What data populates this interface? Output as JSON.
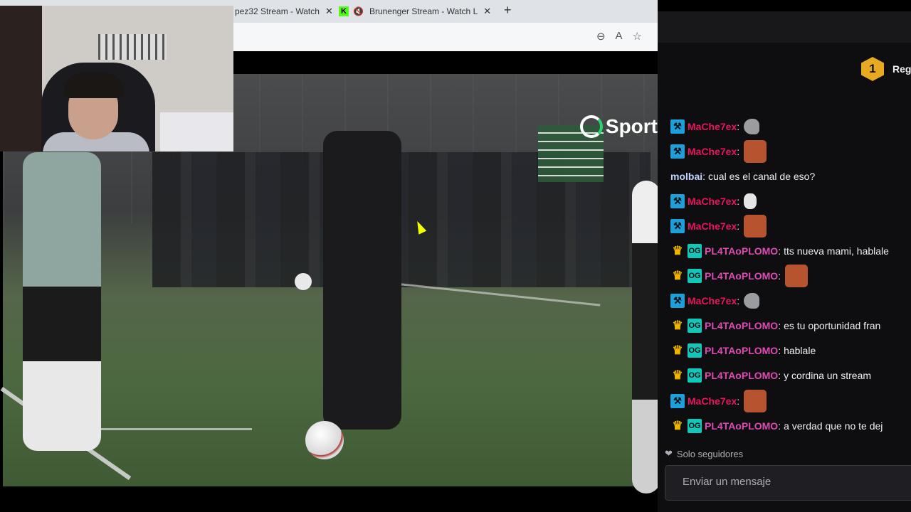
{
  "browser": {
    "tabs": [
      {
        "title": "pez32 Stream - Watch",
        "active": false
      },
      {
        "title": "Brunenger Stream - Watch L",
        "active": true,
        "favicon": "kick-icon",
        "muted": true
      }
    ],
    "new_tab_label": "+"
  },
  "video": {
    "brand_logo_text": "Sport"
  },
  "chat": {
    "rank": {
      "badge": "1",
      "label": "Reg"
    },
    "messages": [
      {
        "badges": [
          "mod"
        ],
        "user": "MaChe7ex",
        "user_color": "#e8155d",
        "text": "",
        "emote": "pigeon"
      },
      {
        "badges": [
          "mod"
        ],
        "user": "MaChe7ex",
        "user_color": "#e8155d",
        "text": "",
        "emote": "face"
      },
      {
        "badges": [],
        "user": "molbai",
        "user_color": "#c3d4ff",
        "text": "cual es el canal de eso?",
        "emote": ""
      },
      {
        "badges": [
          "mod"
        ],
        "user": "MaChe7ex",
        "user_color": "#e8155d",
        "text": "",
        "emote": "hand"
      },
      {
        "badges": [
          "mod"
        ],
        "user": "MaChe7ex",
        "user_color": "#e8155d",
        "text": "",
        "emote": "face"
      },
      {
        "badges": [
          "crown",
          "og"
        ],
        "user": "PL4TAoPLOMO",
        "user_color": "#e04ab4",
        "text": "tts nueva mami, hablale",
        "emote": ""
      },
      {
        "badges": [
          "crown",
          "og"
        ],
        "user": "PL4TAoPLOMO",
        "user_color": "#e04ab4",
        "text": "",
        "emote": "face"
      },
      {
        "badges": [
          "mod"
        ],
        "user": "MaChe7ex",
        "user_color": "#e8155d",
        "text": "",
        "emote": "pigeon"
      },
      {
        "badges": [
          "crown",
          "og"
        ],
        "user": "PL4TAoPLOMO",
        "user_color": "#e04ab4",
        "text": "es tu oportunidad fran",
        "emote": ""
      },
      {
        "badges": [
          "crown",
          "og"
        ],
        "user": "PL4TAoPLOMO",
        "user_color": "#e04ab4",
        "text": "hablale",
        "emote": ""
      },
      {
        "badges": [
          "crown",
          "og"
        ],
        "user": "PL4TAoPLOMO",
        "user_color": "#e04ab4",
        "text": "y cordina un stream",
        "emote": ""
      },
      {
        "badges": [
          "mod"
        ],
        "user": "MaChe7ex",
        "user_color": "#e8155d",
        "text": "",
        "emote": "face"
      },
      {
        "badges": [
          "crown",
          "og"
        ],
        "user": "PL4TAoPLOMO",
        "user_color": "#e04ab4",
        "text": "a verdad que no te dej",
        "emote": ""
      }
    ],
    "followers_only_label": "Solo seguidores",
    "input_placeholder": "Enviar un mensaje"
  },
  "colors": {
    "chat_bg": "#0e0e10",
    "mod_badge": "#1e9fd9",
    "crown_badge": "#f0b400",
    "og_badge": "#12c7ba"
  }
}
